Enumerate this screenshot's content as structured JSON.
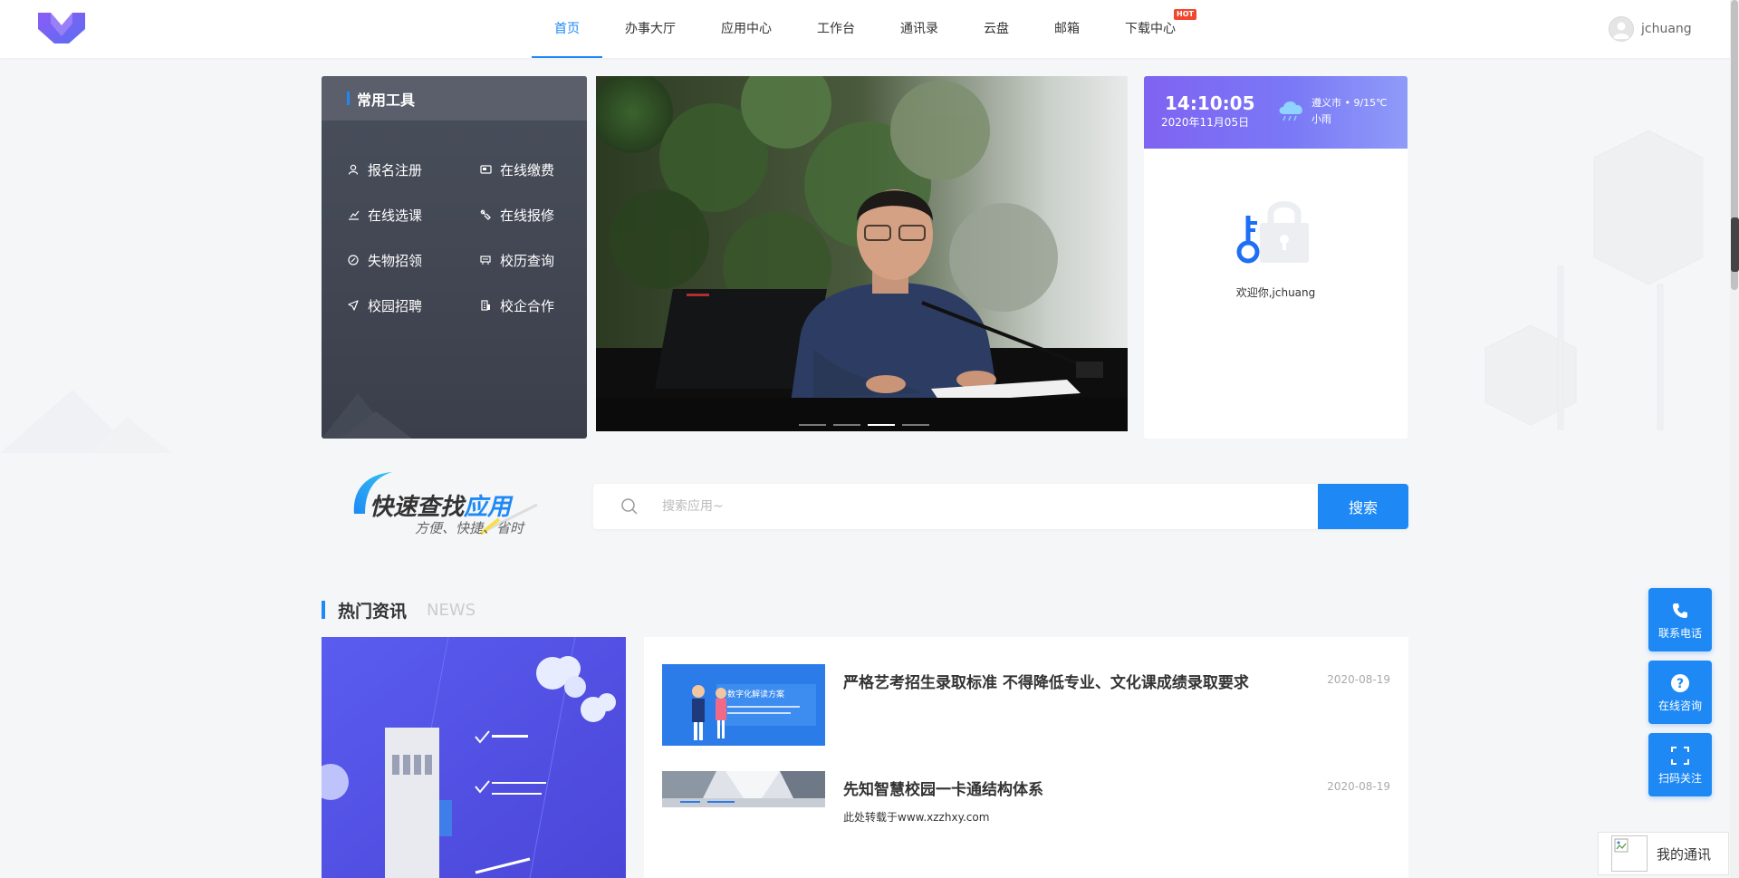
{
  "header": {
    "nav": [
      {
        "label": "首页",
        "active": true
      },
      {
        "label": "办事大厅",
        "active": false
      },
      {
        "label": "应用中心",
        "active": false
      },
      {
        "label": "工作台",
        "active": false
      },
      {
        "label": "通讯录",
        "active": false
      },
      {
        "label": "云盘",
        "active": false
      },
      {
        "label": "邮箱",
        "active": false
      },
      {
        "label": "下载中心",
        "active": false,
        "badge": "HOT"
      }
    ],
    "username": "jchuang"
  },
  "tools": {
    "title": "常用工具",
    "items": [
      {
        "label": "报名注册",
        "icon": "user-icon"
      },
      {
        "label": "在线缴费",
        "icon": "payment-icon"
      },
      {
        "label": "在线选课",
        "icon": "course-icon"
      },
      {
        "label": "在线报修",
        "icon": "repair-icon"
      },
      {
        "label": "失物招领",
        "icon": "lost-found-icon"
      },
      {
        "label": "校历查询",
        "icon": "calendar-icon"
      },
      {
        "label": "校园招聘",
        "icon": "send-icon"
      },
      {
        "label": "校企合作",
        "icon": "building-icon"
      }
    ]
  },
  "banner": {
    "slide_count": 4,
    "active_slide": 3
  },
  "welcome": {
    "time": "14:10:05",
    "date": "2020年11月05日",
    "location": "遵义市 • 9/15℃",
    "weather": "小雨",
    "greeting": "欢迎你,jchuang"
  },
  "quick_search": {
    "title_part1": "快速查找",
    "title_part2": "应用",
    "subtitle": "方便、快捷、省时",
    "placeholder": "搜索应用~",
    "button": "搜索"
  },
  "news": {
    "title": "热门资讯",
    "title_en": "NEWS",
    "items": [
      {
        "title": "严格艺考招生录取标准 不得降低专业、文化课成绩录取要求",
        "date": "2020-08-19",
        "desc": "",
        "thumb_text": "数字化解读方案"
      },
      {
        "title": "先知智慧校园一卡通结构体系",
        "date": "2020-08-19",
        "desc": "此处转载于www.xzzhxy.com",
        "thumb_text": ""
      }
    ]
  },
  "float": {
    "phone": "联系电话",
    "consult": "在线咨询",
    "scan": "扫码关注",
    "chat": "我的通讯"
  },
  "colors": {
    "accent": "#1e89f5",
    "hot": "#f0472d",
    "tools_bg": "#3b3f4b",
    "welcome_gradient": "#7f63f2"
  }
}
